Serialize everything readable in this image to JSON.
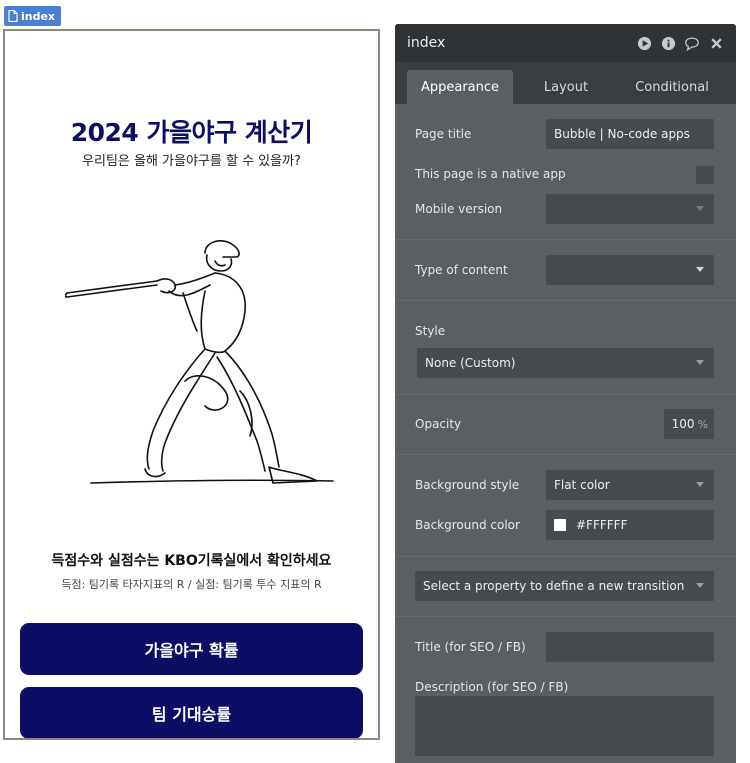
{
  "page_tag": {
    "label": "index"
  },
  "canvas": {
    "title": "2024 가을야구 계산기",
    "subtitle": "우리팀은 올해 가을야구를 할 수 있을까?",
    "info_line1": "득점수와 실점수는 KBO기록실에서 확인하세요",
    "info_line2": "득점: 팀기록 타자지표의 R / 실점: 팀기록 투수 지표의 R",
    "button1": "가을야구 확률",
    "button2": "팀 기대승률",
    "background": "#FFFFFF",
    "accent": "#0D0D66"
  },
  "panel": {
    "title": "index",
    "tabs": [
      {
        "label": "Appearance",
        "active": true
      },
      {
        "label": "Layout",
        "active": false
      },
      {
        "label": "Conditional",
        "active": false
      }
    ],
    "page_title": {
      "label": "Page title",
      "value": "Bubble | No-code apps"
    },
    "native_app": {
      "label": "This page is a native app",
      "checked": false
    },
    "mobile_version": {
      "label": "Mobile version",
      "value": ""
    },
    "type_of_content": {
      "label": "Type of content",
      "value": ""
    },
    "style": {
      "label": "Style",
      "value": "None (Custom)"
    },
    "opacity": {
      "label": "Opacity",
      "value": "100",
      "unit": "%"
    },
    "background_style": {
      "label": "Background style",
      "value": "Flat color"
    },
    "background_color": {
      "label": "Background color",
      "value": "#FFFFFF"
    },
    "transition": {
      "placeholder": "Select a property to define a new transition"
    },
    "seo_title": {
      "label": "Title (for SEO / FB)",
      "value": ""
    },
    "seo_description": {
      "label": "Description (for SEO / FB)",
      "value": ""
    }
  },
  "icons": [
    "file-icon",
    "play-icon",
    "info-icon",
    "comment-icon",
    "close-icon",
    "chevron-down-icon"
  ]
}
